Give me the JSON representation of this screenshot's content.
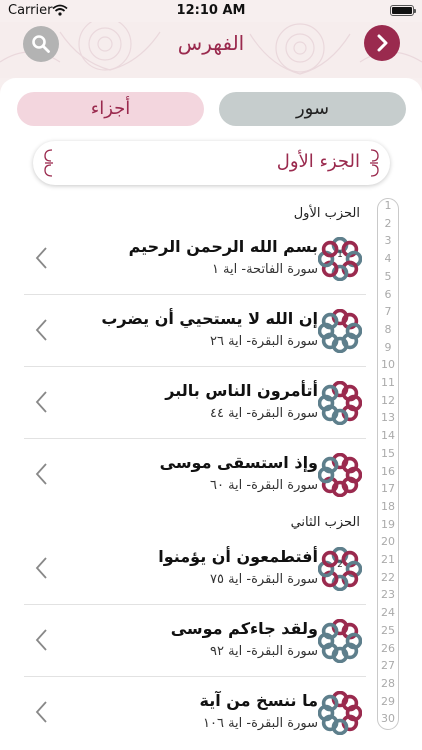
{
  "status_bar": {
    "carrier": "Carrier",
    "time": "12:10 AM"
  },
  "header": {
    "title": "الفهرس"
  },
  "colors": {
    "accent": "#9a2a4e",
    "secondary": "#5e7f8c",
    "inactive": "#c6cdcd"
  },
  "segments": {
    "parts": "أجزاء",
    "suras": "سور"
  },
  "juz": {
    "title": "الجزء الأول"
  },
  "sections": [
    {
      "header": "الحزب الأول",
      "hizb": "1",
      "rows": [
        {
          "title": "بسم الله الرحمن الرحيم",
          "subtitle": "سورة الفاتحة- اية ١"
        },
        {
          "title": "إن الله لا يستحيي أن يضرب",
          "subtitle": "سورة البقرة- اية ٢٦"
        },
        {
          "title": "أتأمرون الناس بالبر",
          "subtitle": "سورة البقرة- اية ٤٤"
        },
        {
          "title": "وإذ استسقى موسى",
          "subtitle": "سورة البقرة- اية ٦٠"
        }
      ]
    },
    {
      "header": "الحزب الثاني",
      "hizb": "2",
      "rows": [
        {
          "title": "أفتطمعون أن يؤمنوا",
          "subtitle": "سورة البقرة- اية ٧٥"
        },
        {
          "title": "ولقد جاءكم موسى",
          "subtitle": "سورة البقرة- اية ٩٢"
        },
        {
          "title": "ما ننسخ من آية",
          "subtitle": "سورة البقرة- اية ١٠٦"
        }
      ]
    }
  ],
  "index": [
    "1",
    "2",
    "3",
    "4",
    "5",
    "6",
    "7",
    "8",
    "9",
    "10",
    "11",
    "12",
    "13",
    "14",
    "15",
    "16",
    "17",
    "18",
    "19",
    "20",
    "21",
    "22",
    "23",
    "24",
    "25",
    "26",
    "27",
    "28",
    "29",
    "30"
  ]
}
